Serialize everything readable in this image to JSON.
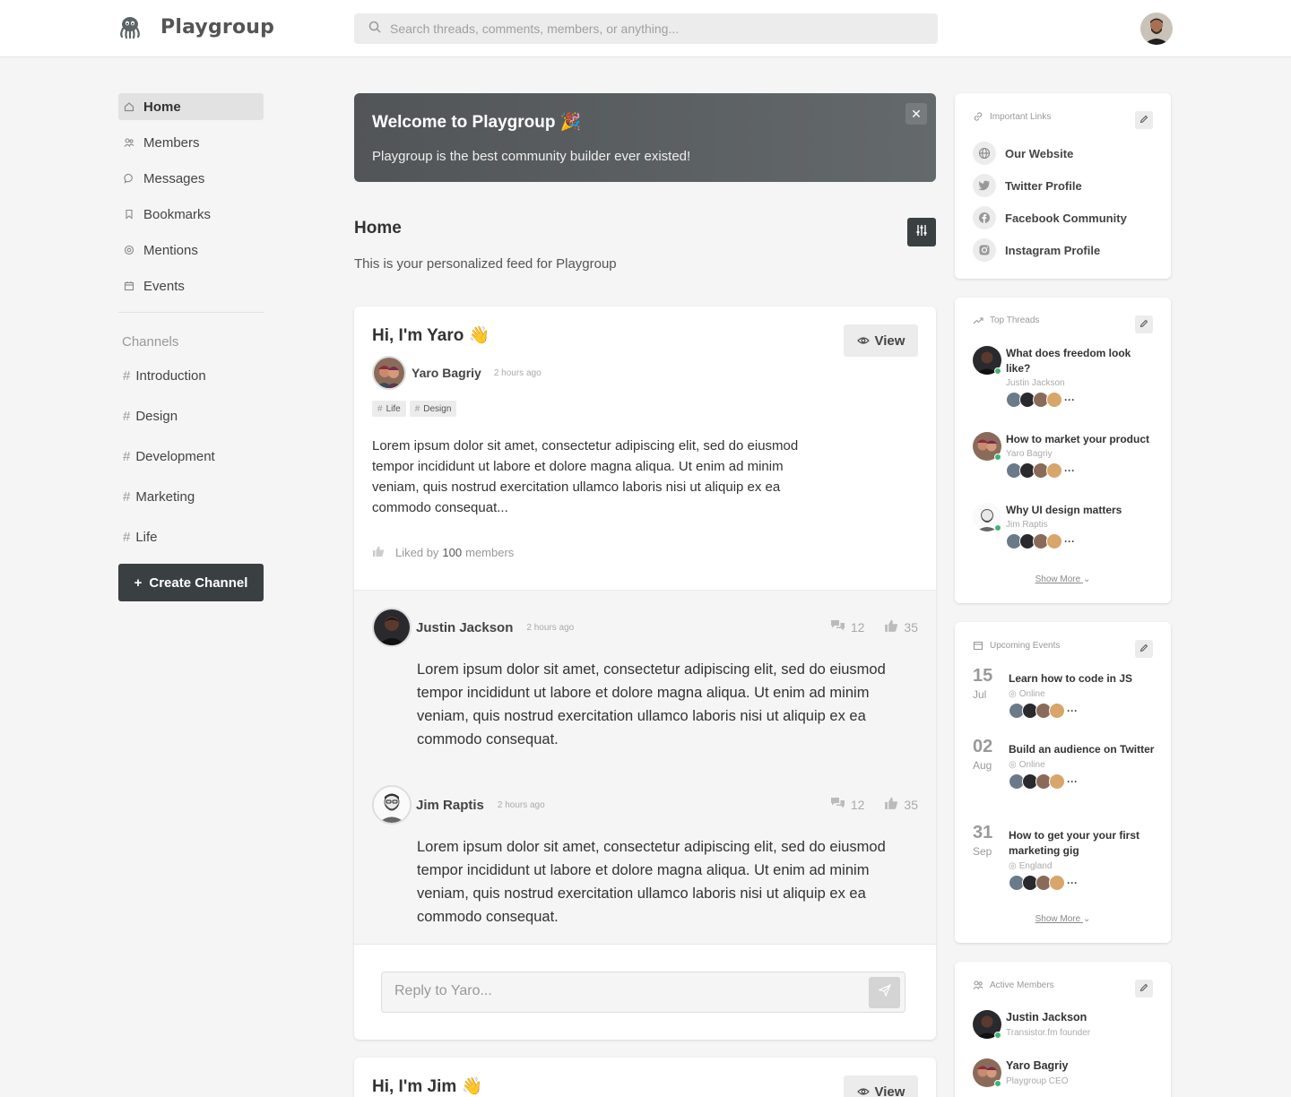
{
  "app": {
    "name": "Playgroup"
  },
  "search": {
    "placeholder": "Search threads, comments, members, or anything..."
  },
  "nav": {
    "items": [
      {
        "label": "Home",
        "icon": "home-icon",
        "active": true
      },
      {
        "label": "Members",
        "icon": "members-icon"
      },
      {
        "label": "Messages",
        "icon": "message-icon"
      },
      {
        "label": "Bookmarks",
        "icon": "bookmark-icon"
      },
      {
        "label": "Mentions",
        "icon": "at-icon"
      },
      {
        "label": "Events",
        "icon": "calendar-icon"
      }
    ],
    "channels_heading": "Channels",
    "channels": [
      "Introduction",
      "Design",
      "Development",
      "Marketing",
      "Life"
    ],
    "create_channel": "Create Channel"
  },
  "welcome": {
    "title": "Welcome to Playgroup 🎉",
    "text": "Playgroup is the best community builder ever existed!"
  },
  "feed": {
    "title": "Home",
    "subtitle": "This is your personalized feed for Playgroup"
  },
  "post": {
    "title": "Hi, I'm Yaro 👋",
    "view_label": "View",
    "author": "Yaro Bagriy",
    "time": "2 hours ago",
    "tags": [
      "Life",
      "Design"
    ],
    "body": "Lorem ipsum dolor sit amet, consectetur adipiscing elit, sed do eiusmod tempor incididunt ut labore et dolore magna aliqua. Ut enim ad minim veniam, quis nostrud exercitation ullamco laboris nisi ut aliquip ex ea commodo consequat...",
    "liked_prefix": "Liked by",
    "liked_count": "100",
    "liked_suffix": "members",
    "replies": [
      {
        "author": "Justin Jackson",
        "time": "2 hours ago",
        "comments": "12",
        "likes": "35",
        "body": "Lorem ipsum dolor sit amet, consectetur adipiscing elit, sed do eiusmod tempor incididunt ut labore et dolore magna aliqua. Ut enim ad minim veniam, quis nostrud exercitation ullamco laboris nisi ut aliquip ex ea commodo consequat."
      },
      {
        "author": "Jim Raptis",
        "time": "2 hours ago",
        "comments": "12",
        "likes": "35",
        "body": "Lorem ipsum dolor sit amet, consectetur adipiscing elit, sed do eiusmod tempor incididunt ut labore et dolore magna aliqua. Ut enim ad minim veniam, quis nostrud exercitation ullamco laboris nisi ut aliquip ex ea commodo consequat."
      }
    ],
    "reply_placeholder": "Reply to Yaro..."
  },
  "post2": {
    "title": "Hi, I'm Jim 👋",
    "view_label": "View"
  },
  "links": {
    "title": "Important Links",
    "items": [
      {
        "label": "Our Website",
        "icon": "globe-icon"
      },
      {
        "label": "Twitter Profile",
        "icon": "twitter-icon"
      },
      {
        "label": "Facebook Community",
        "icon": "facebook-icon"
      },
      {
        "label": "Instagram Profile",
        "icon": "instagram-icon"
      }
    ]
  },
  "threads": {
    "title": "Top Threads",
    "items": [
      {
        "title": "What does freedom look like?",
        "author": "Justin Jackson"
      },
      {
        "title": "How to market your product",
        "author": "Yaro Bagriy"
      },
      {
        "title": "Why UI design matters",
        "author": "Jim Raptis"
      }
    ],
    "show_more": "Show More"
  },
  "events": {
    "title": "Upcoming Events",
    "items": [
      {
        "day": "15",
        "month": "Jul",
        "title": "Learn how to code in JS",
        "location": "Online"
      },
      {
        "day": "02",
        "month": "Aug",
        "title": "Build an audience on Twitter",
        "location": "Online"
      },
      {
        "day": "31",
        "month": "Sep",
        "title": "How to get your your first marketing gig",
        "location": "England"
      }
    ],
    "show_more": "Show More"
  },
  "members": {
    "title": "Active Members",
    "items": [
      {
        "name": "Justin Jackson",
        "role": "Transistor.fm founder"
      },
      {
        "name": "Yaro Bagriy",
        "role": "Playgroup CEO"
      }
    ]
  },
  "colors": {
    "accent": "#3a4042",
    "online": "#3cb371",
    "banner": "#5a5f61"
  }
}
